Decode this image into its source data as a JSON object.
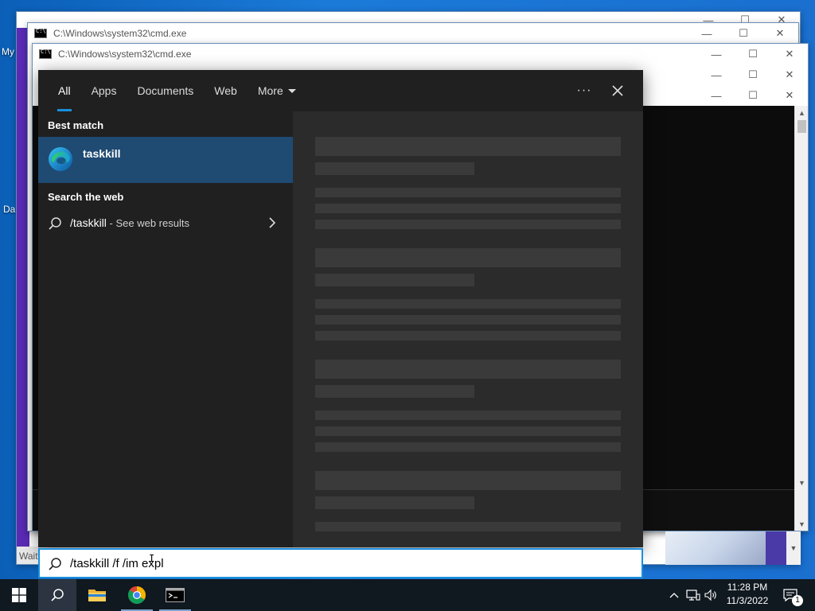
{
  "desktop": {
    "icon_labels": [
      "My",
      "Da"
    ],
    "waiting_label": "Wait"
  },
  "cmd_windows": [
    {
      "title": "C:\\Windows\\system32\\cmd.exe"
    },
    {
      "title": "C:\\Windows\\system32\\cmd.exe"
    }
  ],
  "window_controls": {
    "minimize": "—",
    "maximize": "☐",
    "close": "✕"
  },
  "search": {
    "tabs": [
      {
        "label": "All",
        "active": true
      },
      {
        "label": "Apps"
      },
      {
        "label": "Documents"
      },
      {
        "label": "Web"
      },
      {
        "label": "More"
      }
    ],
    "more_options": "···",
    "best_match_heading": "Best match",
    "best_match": {
      "name": "taskkill",
      "icon": "edge-icon"
    },
    "web_heading": "Search the web",
    "web_result": {
      "query": "/taskkill",
      "suffix": " - See web results"
    },
    "input_value": "/taskkill /f /im expl"
  },
  "taskbar": {
    "apps": [
      "start-icon",
      "search-icon",
      "file-explorer-icon",
      "chrome-icon",
      "cmd-icon"
    ],
    "time": "11:28 PM",
    "date": "11/3/2022",
    "notification_count": "1"
  },
  "colors": {
    "accent": "#1a8fdd",
    "selected_row": "#1f4a72",
    "panel_bg": "#202020"
  }
}
